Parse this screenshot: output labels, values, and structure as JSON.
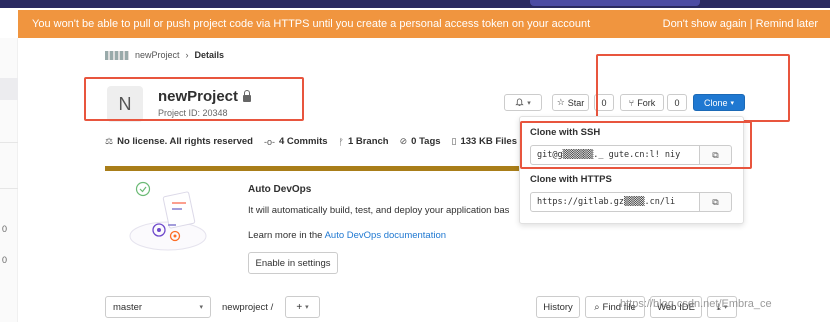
{
  "banner": {
    "message": "You won't be able to pull or push project code via HTTPS until you create a personal access token on your account",
    "actions": "Don't show again | Remind later"
  },
  "left_rail": {
    "marks": [
      "0",
      "0"
    ]
  },
  "breadcrumb": {
    "project": "newProject",
    "separator": "›",
    "current": "Details"
  },
  "project": {
    "avatar_letter": "N",
    "name": "newProject",
    "id_label": "Project ID: 20348"
  },
  "actions": {
    "star_label": "Star",
    "star_count": "0",
    "fork_label": "Fork",
    "fork_count": "0",
    "clone_label": "Clone"
  },
  "stats": {
    "license": "No license. All rights reserved",
    "commits": "4 Commits",
    "branches": "1 Branch",
    "tags": "0 Tags",
    "files": "133 KB Files"
  },
  "auto_devops": {
    "title": "Auto DevOps",
    "text": "It will automatically build, test, and deploy your application bas",
    "learn_prefix": "Learn more in the ",
    "learn_link": "Auto DevOps documentation",
    "enable_button": "Enable in settings"
  },
  "clone_dropdown": {
    "ssh_label": "Clone with SSH",
    "ssh_url": "git@g▒▒▒▒▒▒._ gute.cn:l! niy",
    "https_label": "Clone with HTTPS",
    "https_url": "https://gitlab.gz▒▒▒▒.cn/li"
  },
  "repo_bar": {
    "branch": "master",
    "path": "newproject",
    "path_sep": "/",
    "add": "+",
    "history": "History",
    "find_file": "Find file",
    "web_ide": "Web IDE"
  },
  "watermark": "https://blog.csdn.net/Embra_ce"
}
